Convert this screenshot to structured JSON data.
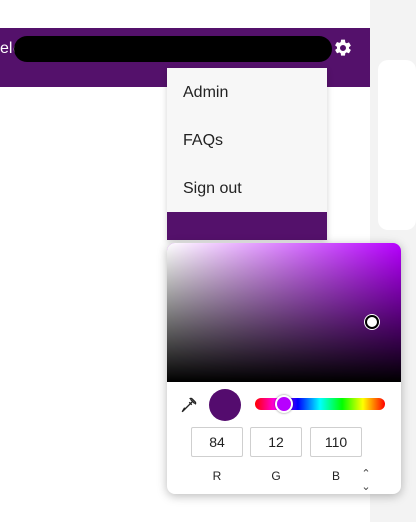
{
  "header": {
    "greeting_prefix": "el@",
    "settings_icon": "gear-icon"
  },
  "menu": {
    "items": [
      {
        "label": "Admin"
      },
      {
        "label": "FAQs"
      },
      {
        "label": "Sign out"
      }
    ]
  },
  "color_picker": {
    "hue_color": "#b700ff",
    "selected_color": "#540c6e",
    "rgb": {
      "r": "84",
      "g": "12",
      "b": "110"
    },
    "labels": {
      "r": "R",
      "g": "G",
      "b": "B"
    },
    "eyedropper_icon": "eyedropper-icon",
    "mode_toggle_icon": "up-down-icon"
  },
  "colors": {
    "brand_purple": "#54116b"
  }
}
